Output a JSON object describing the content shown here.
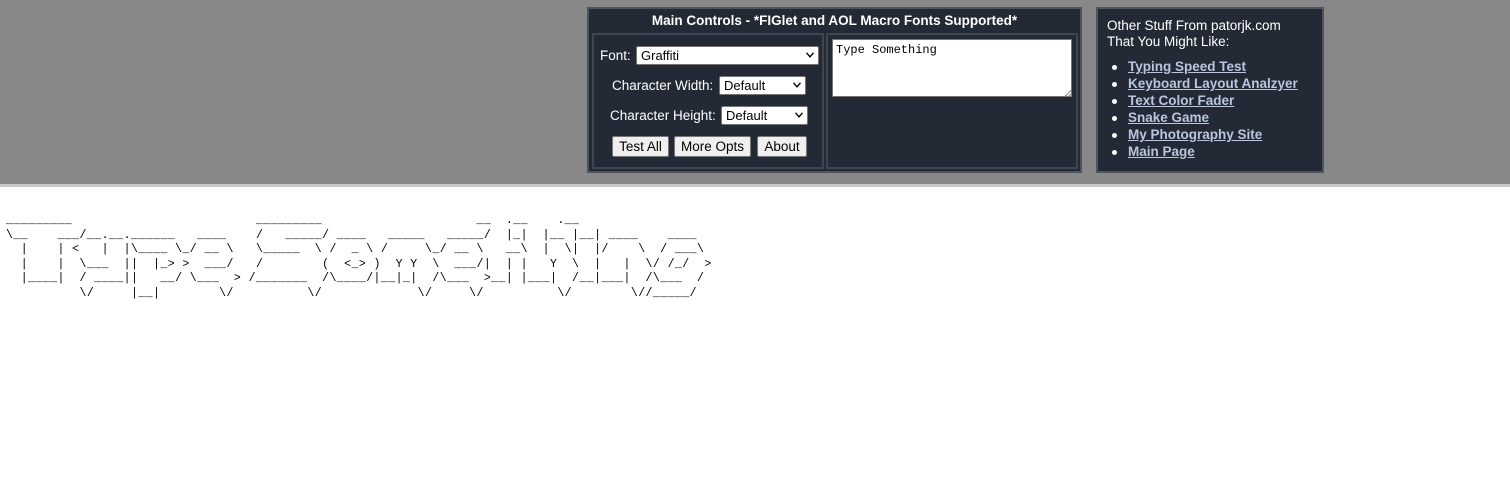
{
  "main_controls": {
    "title": "Main Controls - *FIGlet and AOL Macro Fonts Supported*",
    "font_label": "Font:",
    "font_value": "Graffiti",
    "char_width_label": "Character Width:",
    "char_width_value": "Default",
    "char_height_label": "Character Height:",
    "char_height_value": "Default",
    "buttons": {
      "test_all": "Test All",
      "more_opts": "More Opts",
      "about": "About"
    },
    "text_input_value": "Type Something"
  },
  "other_stuff": {
    "heading": "Other Stuff From patorjk.com That You Might Like:",
    "links": [
      "Typing Speed Test",
      "Keyboard Layout Analzyer",
      "Text Color Fader",
      "Snake Game",
      "My Photography Site",
      "Main Page"
    ]
  },
  "output": {
    "ascii_art": "_________                         _________                     __  .__    .__\n\\__    ___/__.__.______   ____    /   _____/ ____   _____   _____/  |_|  |__ |__| ____    ____\n  |    | <   |  |\\____ \\_/ __ \\   \\_____  \\ /  _ \\ /     \\_/ __ \\   __\\  |  \\|  |/    \\  / ___\\\n  |    |  \\___  ||  |_> >  ___/   /        (  <_> )  Y Y  \\  ___/|  | |   Y  \\  |   |  \\/ /_/  >\n  |____|  / ____||   __/ \\___  > /_______  /\\____/|__|_|  /\\___  >__| |___|  /__|___|  /\\___  /\n          \\/     |__|        \\/          \\/             \\/     \\/          \\/        \\//_____/"
  },
  "colors": {
    "header_bg": "#888888",
    "panel_bg": "#232a36",
    "link": "#b9c6de"
  }
}
